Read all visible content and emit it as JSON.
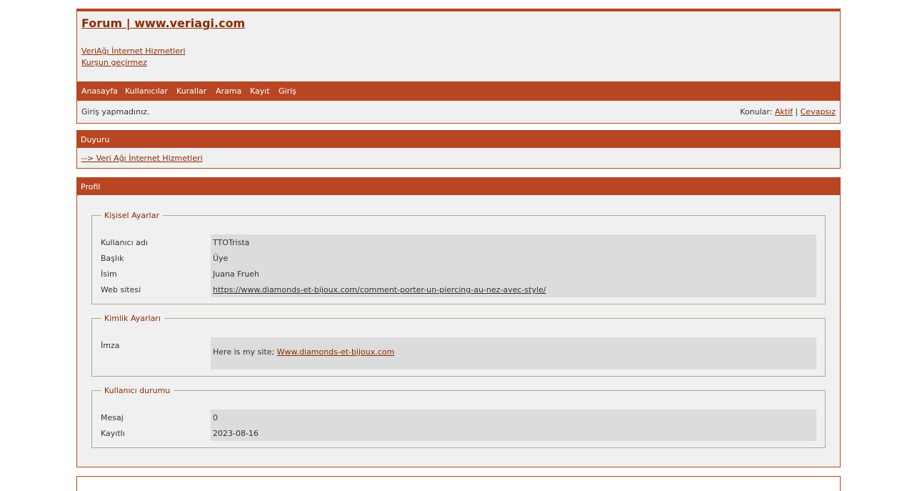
{
  "header": {
    "board_title": "Forum | www.veriagi.com",
    "desc_link_1": "VeriAğı İnternet Hizmetleri",
    "desc_link_2": "Kurşun geçirmez"
  },
  "nav": {
    "items": [
      "Anasayfa",
      "Kullanıcılar",
      "Kurallar",
      "Arama",
      "Kayıt",
      "Giriş"
    ]
  },
  "status": {
    "left": "Giriş yapmadınız.",
    "topics_label": "Konular: ",
    "active": "Aktif",
    "separator": " | ",
    "unanswered": "Cevapsız"
  },
  "announcement": {
    "heading": "Duyuru",
    "link": "--> Veri Ağı İnternet Hizmetleri"
  },
  "profile": {
    "heading": "Profil",
    "personal": {
      "legend": "Kişisel Ayarlar",
      "rows": [
        {
          "label": "Kullanıcı adı",
          "value": "TTOTrista"
        },
        {
          "label": "Başlık",
          "value": "Üye"
        },
        {
          "label": "İsim",
          "value": "Juana Frueh"
        },
        {
          "label": "Web sitesi",
          "value": "https://www.diamonds-et-bijoux.com/comment-porter-un-piercing-au-nez-avec-style/"
        }
      ]
    },
    "identity": {
      "legend": "Kimlik Ayarları",
      "label": "İmza",
      "text": "Here is my site; ",
      "link": "Www.diamonds-et-bijoux.com"
    },
    "user_status": {
      "legend": "Kullanıcı durumu",
      "rows": [
        {
          "label": "Mesaj",
          "value": "0"
        },
        {
          "label": "Kayıtlı",
          "value": "2023-08-16"
        }
      ]
    }
  },
  "colors": {
    "accent": "#b84623",
    "link": "#8b2b00",
    "panel_bg": "#f0f0f0",
    "value_bg": "#dcdcdc"
  }
}
